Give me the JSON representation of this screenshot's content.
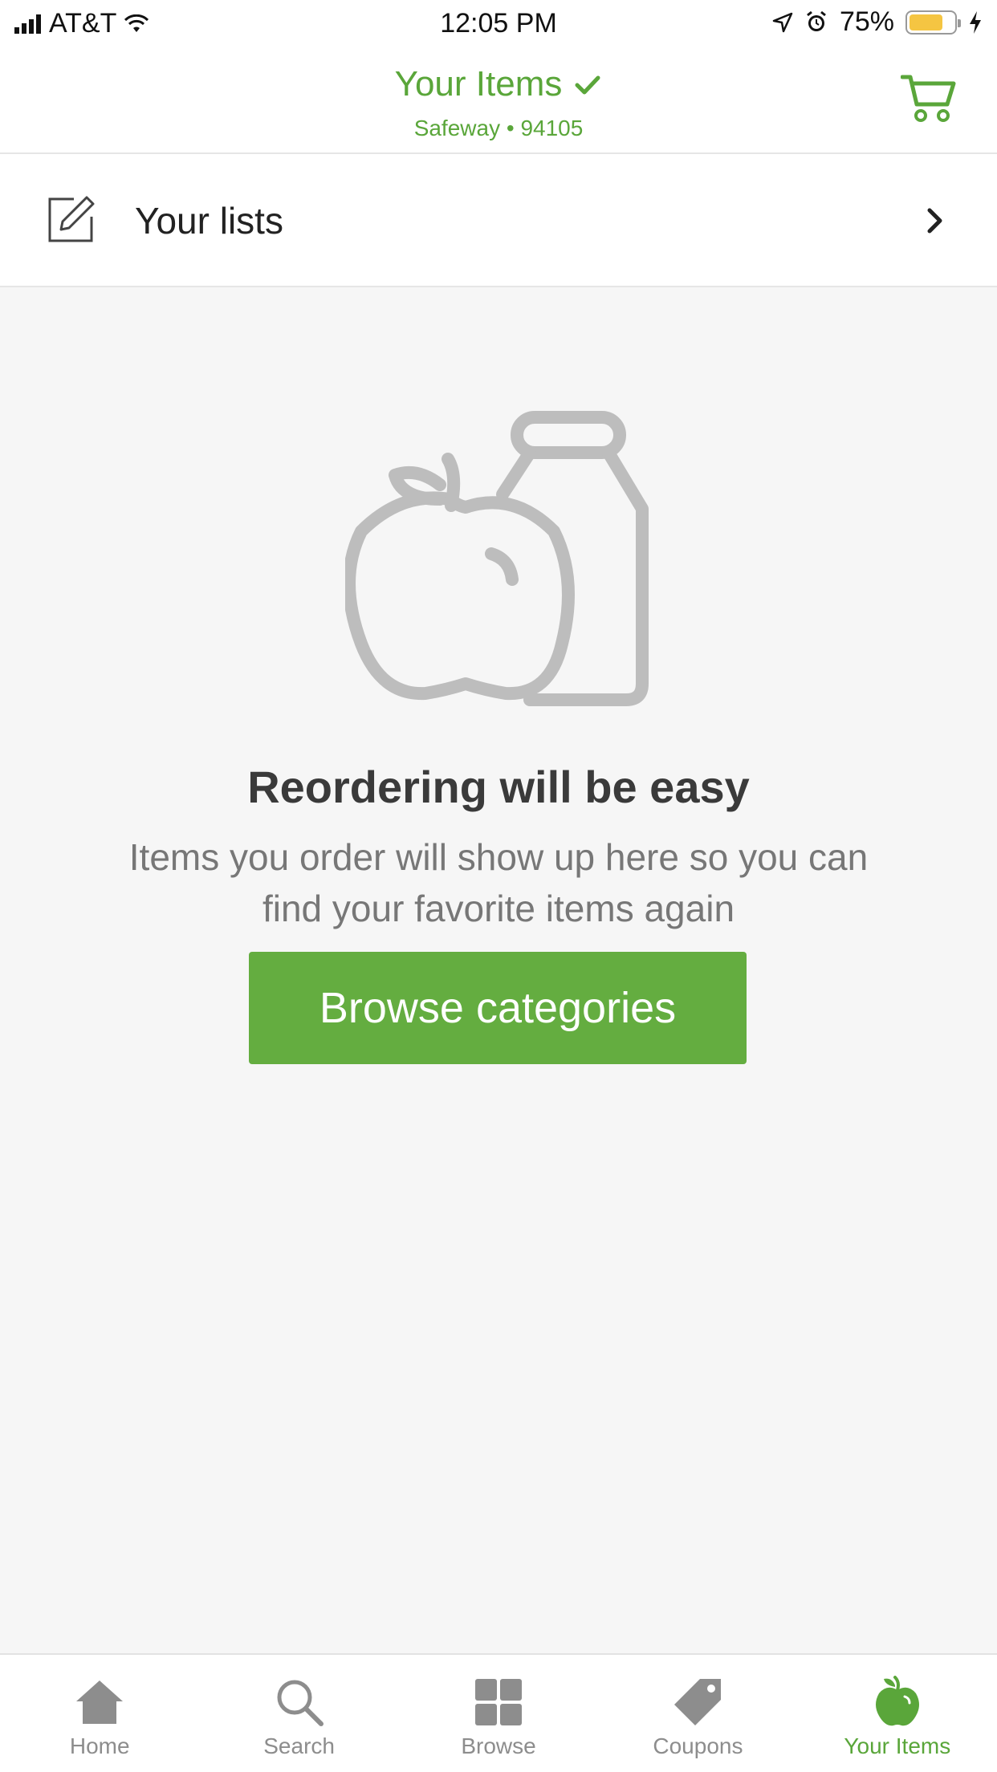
{
  "status_bar": {
    "carrier": "AT&T",
    "time": "12:05 PM",
    "battery": "75%"
  },
  "header": {
    "title": "Your Items",
    "subtitle": "Safeway • 94105"
  },
  "lists_row": {
    "label": "Your lists"
  },
  "empty_state": {
    "title": "Reordering will be easy",
    "description": "Items you order will show up here so you can find your favorite items again",
    "button_label": "Browse categories"
  },
  "tab_bar": {
    "items": [
      {
        "label": "Home",
        "icon": "home-icon"
      },
      {
        "label": "Search",
        "icon": "search-icon"
      },
      {
        "label": "Browse",
        "icon": "grid-icon"
      },
      {
        "label": "Coupons",
        "icon": "tag-icon"
      },
      {
        "label": "Your Items",
        "icon": "apple-icon",
        "active": true
      }
    ]
  },
  "colors": {
    "accent": "#64ad40",
    "accent_text": "#5aa63a",
    "battery": "#f5c542",
    "placeholder_gray": "#bdbdbd"
  }
}
